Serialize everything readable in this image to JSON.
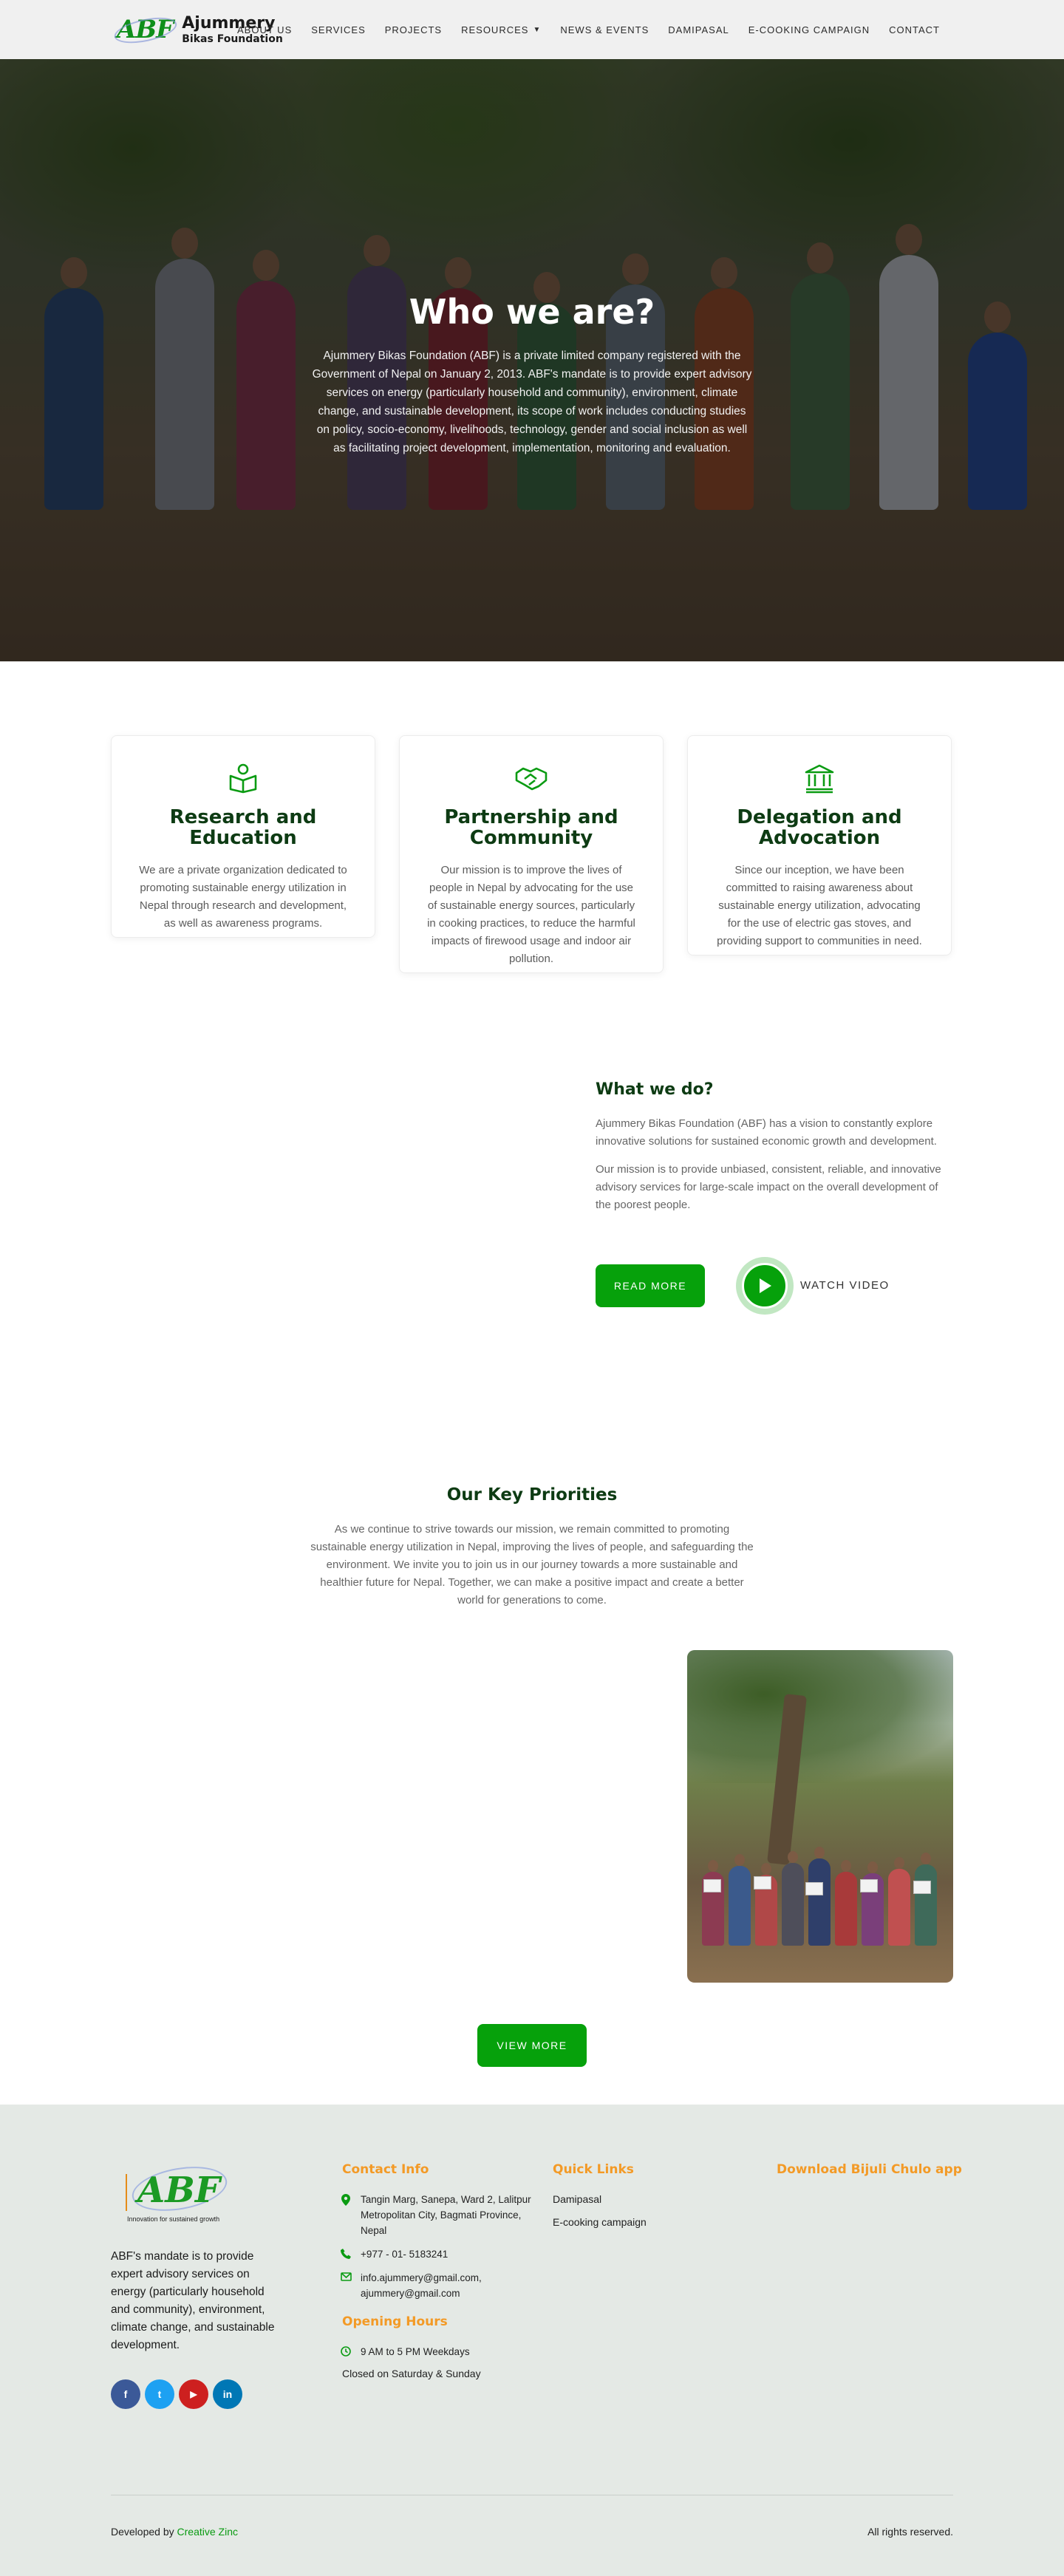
{
  "header": {
    "logo_mark": "ABF",
    "logo_line1": "Ajummery",
    "logo_line2": "Bikas Foundation",
    "nav": [
      "ABOUT US",
      "SERVICES",
      "PROJECTS",
      "RESOURCES",
      "NEWS & EVENTS",
      "DAMIPASAL",
      "E-COOKING CAMPAIGN",
      "CONTACT"
    ]
  },
  "hero": {
    "title": "Who we are?",
    "text": "Ajummery Bikas Foundation (ABF) is a private limited company registered with the Government of Nepal on January 2, 2013. ABF's mandate is to provide expert advisory services on energy (particularly household and community), environment, climate change, and sustainable development, its scope of work includes conducting studies on policy, socio-economy, livelihoods, technology, gender and social inclusion as well as facilitating project development, implementation, monitoring and evaluation."
  },
  "features": [
    {
      "icon": "education-icon",
      "title": "Research and Education",
      "text": "We are a private organization dedicated to promoting sustainable energy utilization in Nepal through research and development, as well as awareness programs."
    },
    {
      "icon": "handshake-icon",
      "title": "Partnership and Community",
      "text": "Our mission is to improve the lives of people in Nepal by advocating for the use of sustainable energy sources, particularly in cooking practices, to reduce the harmful impacts of firewood usage and indoor air pollution."
    },
    {
      "icon": "institution-icon",
      "title": "Delegation and Advocation",
      "text": "Since our inception, we have been committed to raising awareness about sustainable energy utilization, advocating for the use of electric gas stoves, and providing support to communities in need."
    }
  ],
  "what_we_do": {
    "title": "What we do?",
    "p1": "Ajummery Bikas Foundation (ABF) has a vision to constantly explore innovative solutions for sustained economic growth and development.",
    "p2": "Our mission is to provide unbiased, consistent, reliable, and innovative advisory services for large-scale impact on the overall development of the poorest people.",
    "read_more": "READ MORE",
    "watch_video": "WATCH VIDEO"
  },
  "key_priorities": {
    "title": "Our Key Priorities",
    "text": "As we continue to strive towards our mission, we remain committed to promoting sustainable energy utilization in Nepal, improving the lives of people, and safeguarding the environment. We invite you to join us in our journey towards a more sustainable and healthier future for Nepal. Together, we can make a positive impact and create a better world for generations to come.",
    "view_more": "VIEW MORE"
  },
  "footer": {
    "logo_mark": "ABF",
    "logo_tagline": "Innovation for sustained growth",
    "about": "ABF's mandate is to provide expert advisory services on energy (particularly household and community), environment, climate change, and sustainable development.",
    "socials": [
      {
        "name": "facebook-icon",
        "glyph": "f",
        "color": "#3b5998"
      },
      {
        "name": "twitter-icon",
        "glyph": "t",
        "color": "#1da1f2"
      },
      {
        "name": "youtube-icon",
        "glyph": "▶",
        "color": "#cd201f"
      },
      {
        "name": "linkedin-icon",
        "glyph": "in",
        "color": "#0077b5"
      }
    ],
    "contact_title": "Contact Info",
    "address": "Tangin Marg, Sanepa, Ward 2, Lalitpur Metropolitan City, Bagmati Province, Nepal",
    "phone": "+977 - 01- 5183241",
    "email": "info.ajummery@gmail.com, ajummery@gmail.com",
    "hours_title": "Opening Hours",
    "hours": "9 AM to 5 PM Weekdays",
    "closed": "Closed on Saturday & Sunday",
    "quick_links_title": "Quick Links",
    "quick_links": [
      "Damipasal",
      "E-cooking campaign"
    ],
    "download_title": "Download Bijuli Chulo app",
    "developed_by": "Developed by",
    "developer": "Creative Zinc",
    "rights": "All rights reserved."
  },
  "colors": {
    "accent": "#06a10b",
    "heading": "#0d3b13",
    "footer_heading": "#f39a26",
    "footer_bg": "#e4e9e5"
  }
}
